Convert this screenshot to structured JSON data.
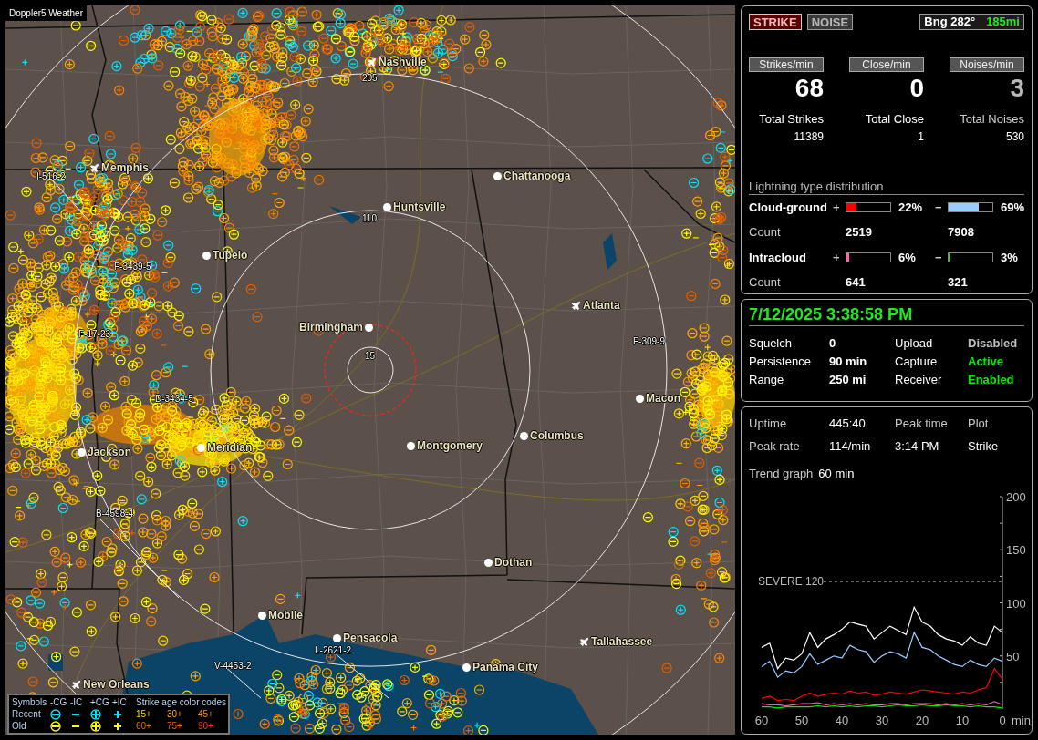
{
  "map": {
    "title": "Doppler5 Weather",
    "cities": [
      {
        "name": "Nashville",
        "kind": "airport"
      },
      {
        "name": "Memphis",
        "kind": "airport"
      },
      {
        "name": "Chattanooga",
        "kind": "city"
      },
      {
        "name": "Huntsville",
        "kind": "city"
      },
      {
        "name": "Tupelo",
        "kind": "city"
      },
      {
        "name": "Atlanta",
        "kind": "airport"
      },
      {
        "name": "Birmingham",
        "kind": "city"
      },
      {
        "name": "Macon",
        "kind": "city"
      },
      {
        "name": "Columbus",
        "kind": "city"
      },
      {
        "name": "Meridian",
        "kind": "city"
      },
      {
        "name": "Jackson",
        "kind": "city"
      },
      {
        "name": "Montgomery",
        "kind": "city"
      },
      {
        "name": "Dothan",
        "kind": "city"
      },
      {
        "name": "Mobile",
        "kind": "city"
      },
      {
        "name": "Tallahassee",
        "kind": "airport"
      },
      {
        "name": "Pensacola",
        "kind": "city"
      },
      {
        "name": "Panama City",
        "kind": "city"
      },
      {
        "name": "New Orleans",
        "kind": "airport"
      }
    ],
    "storm_labels": [
      "I-516-2",
      "F-3439-5",
      "F-17-23",
      "D-3434-5",
      "F-309-9",
      "B-4598-4",
      "L-2621-2",
      "V-4453-2"
    ],
    "range_labels": [
      "205",
      "110",
      "15"
    ],
    "legend": {
      "header": [
        "Symbols",
        "-CG",
        "-IC",
        "+CG",
        "+IC",
        "Strike age color codes"
      ],
      "rows": [
        {
          "label": "Recent",
          "color": "#00e5ff",
          "ages": [
            {
              "text": "15+",
              "color": "#ffd700"
            },
            {
              "text": "30+",
              "color": "#ffb000"
            },
            {
              "text": "45+",
              "color": "#ff9000"
            }
          ]
        },
        {
          "label": "Old",
          "color": "#ffff00",
          "ages": [
            {
              "text": "60+",
              "color": "#e07000"
            },
            {
              "text": "75+",
              "color": "#ff6000"
            },
            {
              "text": "90+",
              "color": "#ff3010"
            }
          ]
        }
      ]
    }
  },
  "mode_buttons": [
    {
      "label": "STRIKE",
      "selected": true
    },
    {
      "label": "NOISE",
      "selected": false
    }
  ],
  "bearing": {
    "angle": "Bng 282°",
    "distance": "185mi"
  },
  "rates": [
    {
      "header": "Strikes/min",
      "value": "68",
      "total_label": "Total Strikes",
      "total": "11389",
      "dimmed": false
    },
    {
      "header": "Close/min",
      "value": "0",
      "total_label": "Total Close",
      "total": "1",
      "dimmed": false
    },
    {
      "header": "Noises/min",
      "value": "3",
      "total_label": "Total Noises",
      "total": "530",
      "dimmed": true
    }
  ],
  "distribution": {
    "title": "Lightning type distribution",
    "groups": [
      {
        "label": "Cloud-ground",
        "count_label": "Count",
        "positive": {
          "sign": "+",
          "level": 0.22,
          "color": "#ff0000",
          "percent": "22%",
          "count": "2519"
        },
        "negative": {
          "sign": "−",
          "level": 0.69,
          "color": "#99ccff",
          "percent": "69%",
          "count": "7908"
        }
      },
      {
        "label": "Intracloud",
        "count_label": "Count",
        "positive": {
          "sign": "+",
          "level": 0.06,
          "color": "#ff66aa",
          "percent": "6%",
          "count": "641"
        },
        "negative": {
          "sign": "−",
          "level": 0.03,
          "color": "#00ee00",
          "percent": "3%",
          "count": "321"
        }
      }
    ]
  },
  "status": {
    "datetime": "7/12/2025 3:38:58 PM",
    "rows": [
      [
        {
          "label": "Squelch",
          "value": "0",
          "color": "#ffffff"
        },
        {
          "label": "Upload",
          "value": "Disabled",
          "color": "#c0c0c0"
        }
      ],
      [
        {
          "label": "Persistence",
          "value": "90 min",
          "color": "#ffffff"
        },
        {
          "label": "Capture",
          "value": "Active",
          "color": "#00ee00"
        }
      ],
      [
        {
          "label": "Range",
          "value": "250 mi",
          "color": "#ffffff"
        },
        {
          "label": "Receiver",
          "value": "Enabled",
          "color": "#00ee00"
        }
      ]
    ]
  },
  "stats": {
    "rows": [
      [
        "Uptime",
        "445:40",
        "Peak time",
        "Plot"
      ],
      [
        "Peak rate",
        "114/min",
        "3:14 PM",
        "Strike"
      ]
    ],
    "trend_label": "Trend graph",
    "trend_value": "60 min",
    "chart_data": {
      "type": "line",
      "xlabel": "min",
      "x": [
        60,
        58,
        56,
        54,
        52,
        50,
        48,
        46,
        44,
        42,
        40,
        38,
        36,
        34,
        32,
        30,
        28,
        26,
        24,
        22,
        20,
        18,
        16,
        14,
        12,
        10,
        8,
        6,
        4,
        2,
        0
      ],
      "xlim": [
        60,
        0
      ],
      "ylim": [
        0,
        200
      ],
      "xticks": [
        60,
        50,
        40,
        30,
        20,
        10,
        0
      ],
      "yticks": [
        50,
        100,
        150,
        200
      ],
      "annotations": [
        "SEVERE 120"
      ],
      "series": [
        {
          "color": "#ffffff",
          "values": [
            58,
            62,
            38,
            48,
            46,
            52,
            72,
            58,
            66,
            70,
            75,
            82,
            80,
            78,
            66,
            72,
            78,
            74,
            70,
            96,
            82,
            78,
            70,
            66,
            64,
            60,
            68,
            62,
            60,
            78,
            72
          ]
        },
        {
          "color": "#99ccff",
          "values": [
            40,
            45,
            30,
            36,
            34,
            40,
            52,
            42,
            46,
            50,
            48,
            60,
            56,
            54,
            44,
            50,
            54,
            52,
            48,
            72,
            58,
            56,
            50,
            46,
            42,
            40,
            46,
            42,
            40,
            48,
            45
          ]
        },
        {
          "color": "#ff0000",
          "values": [
            10,
            12,
            8,
            9,
            8,
            12,
            15,
            12,
            14,
            15,
            14,
            17,
            15,
            16,
            13,
            14,
            16,
            15,
            14,
            16,
            18,
            17,
            16,
            15,
            14,
            16,
            15,
            18,
            20,
            38,
            28
          ]
        },
        {
          "color": "#ff66aa",
          "values": [
            5,
            4,
            4,
            3,
            4,
            5,
            5,
            6,
            4,
            5,
            4,
            5,
            4,
            5,
            4,
            4,
            5,
            5,
            4,
            5,
            5,
            5,
            4,
            5,
            4,
            5,
            4,
            5,
            4,
            7,
            4
          ]
        },
        {
          "color": "#00ee00",
          "values": [
            2,
            2,
            1,
            2,
            2,
            2,
            2,
            3,
            2,
            3,
            2,
            3,
            2,
            3,
            3,
            2,
            3,
            4,
            3,
            3,
            4,
            3,
            3,
            4,
            3,
            3,
            2,
            3,
            2,
            2,
            1
          ]
        }
      ]
    }
  }
}
